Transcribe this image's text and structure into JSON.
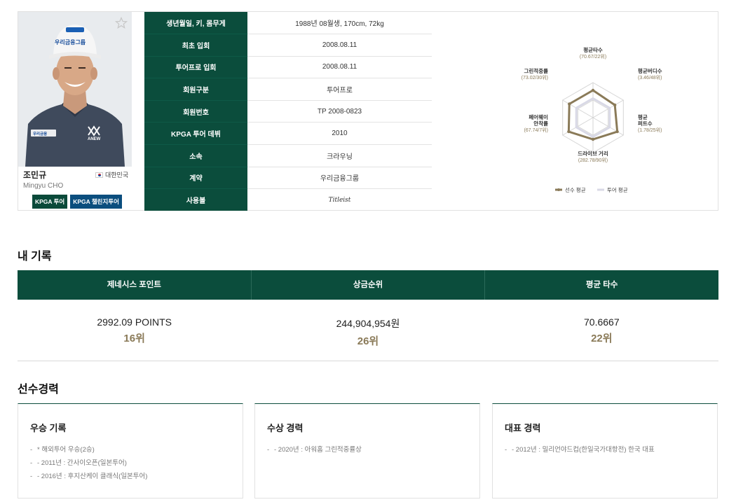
{
  "player": {
    "name": "조민규",
    "name_en": "Mingyu CHO",
    "country": "대한민국",
    "cap_text": "우리금융그룹",
    "shirt_logo": "우리금융",
    "shirt_brand": "ANEW",
    "badges": [
      "KPGA 투어",
      "KPGA 챌린지투어"
    ]
  },
  "info": [
    {
      "label": "생년월일, 키, 몸무게",
      "value": "1988년 08월생, 170cm, 72kg"
    },
    {
      "label": "최초 입회",
      "value": "2008.08.11"
    },
    {
      "label": "투어프로 입회",
      "value": "2008.08.11"
    },
    {
      "label": "회원구분",
      "value": "투어프로"
    },
    {
      "label": "회원번호",
      "value": "TP 2008-0823"
    },
    {
      "label": "KPGA 투어 데뷔",
      "value": "2010"
    },
    {
      "label": "소속",
      "value": "크라우닝"
    },
    {
      "label": "계약",
      "value": "우리금융그룹"
    },
    {
      "label": "사용볼",
      "value": "Titleist"
    }
  ],
  "radar": {
    "axes": [
      {
        "label": "평균타수",
        "sub": "(70.67/22위)"
      },
      {
        "label": "평균버디수",
        "sub": "(3.46/48위)"
      },
      {
        "label": "평균퍼트수",
        "label_lines": [
          "평균",
          "퍼트수"
        ],
        "sub": "(1.78/25위)"
      },
      {
        "label": "드라이브 거리",
        "sub": "(282.78/90위)"
      },
      {
        "label": "페어웨이안착률",
        "label_lines": [
          "페어웨이",
          "안착률"
        ],
        "sub": "(67.74/7위)"
      },
      {
        "label": "그린적중률",
        "sub": "(73.02/30위)"
      }
    ],
    "player_values": [
      0.78,
      0.72,
      0.8,
      0.62,
      0.8,
      0.78
    ],
    "tour_values": [
      0.55,
      0.55,
      0.55,
      0.55,
      0.55,
      0.55
    ],
    "legend_player": "선수 평균",
    "legend_tour": "투어 평균",
    "player_color": "#8a7a58",
    "tour_color": "#d9d9e6"
  },
  "records": {
    "title": "내 기록",
    "headers": [
      "제네시스 포인트",
      "상금순위",
      "평균 타수"
    ],
    "values": [
      "2992.09 POINTS",
      "244,904,954원",
      "70.6667"
    ],
    "ranks": [
      "16위",
      "26위",
      "22위"
    ]
  },
  "career": {
    "title": "선수경력",
    "boxes": [
      {
        "title": "우승 기록",
        "items": [
          "* 해외투어 우승(2승)",
          "- 2011년 : 간사이오픈(일본투어)",
          "- 2016년 : 후지산케이 클래식(일본투어)"
        ]
      },
      {
        "title": "수상 경력",
        "items": [
          "- 2020년 : 아워홈 그린적중률상"
        ]
      },
      {
        "title": "대표 경력",
        "items": [
          "- 2012년 : 밀리언야드컵(한일국가대항전) 한국 대표"
        ]
      }
    ]
  },
  "icons": {
    "favorite": "star-outline-icon",
    "flag": "korea-flag-icon"
  },
  "colors": {
    "primary": "#0b4d3c",
    "accent": "#8a7a58",
    "badge_blue": "#0b4e7e"
  }
}
